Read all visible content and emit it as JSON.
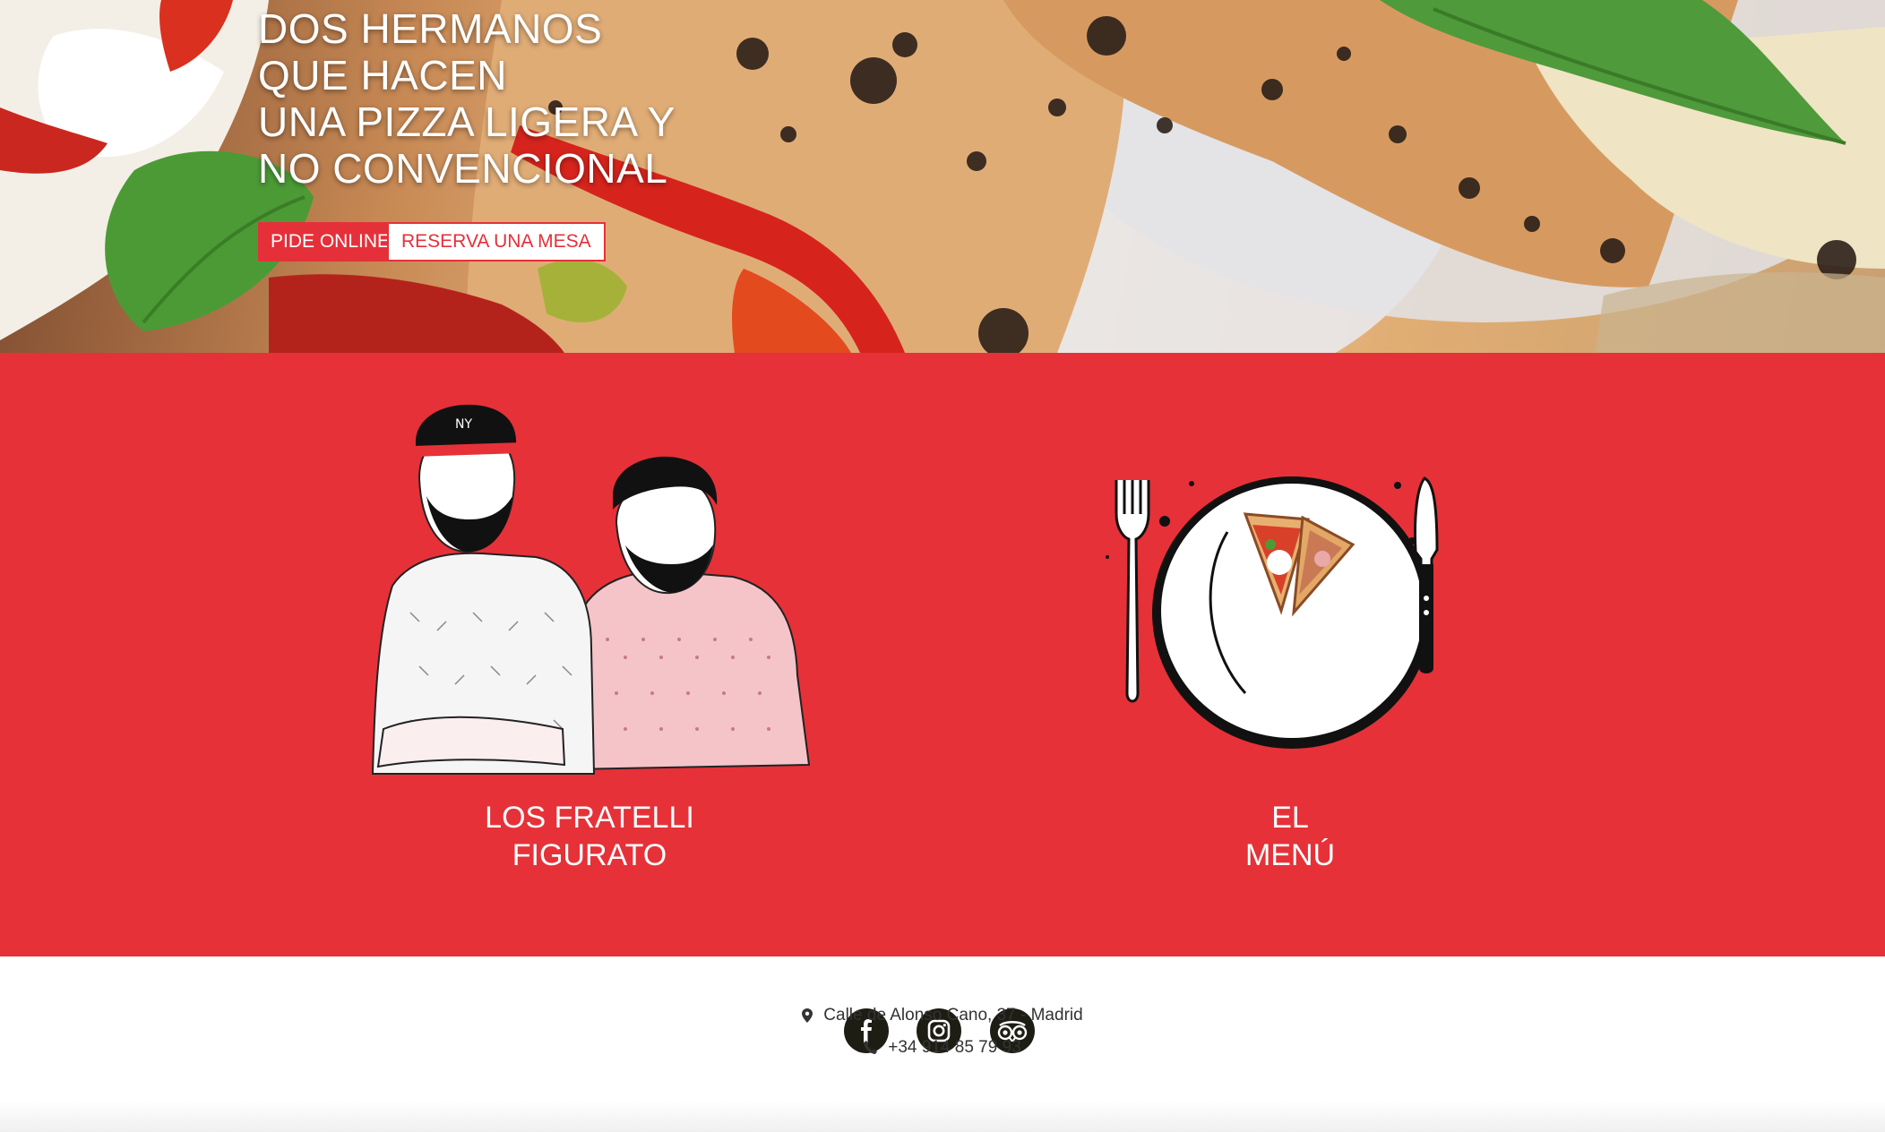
{
  "hero": {
    "title_lines": [
      "DOS HERMANOS",
      "QUE HACEN",
      "UNA PIZZA LIGERA Y",
      "NO CONVENCIONAL"
    ],
    "order_button": "PIDE ONLINE",
    "reserve_button": "RESERVA UNA MESA"
  },
  "features": {
    "brothers": {
      "line1": "LOS FRATELLI",
      "line2": "FIGURATO"
    },
    "menu": {
      "line1": "EL",
      "line2": "MENÚ"
    }
  },
  "footer": {
    "social": [
      "facebook-icon",
      "instagram-icon",
      "tripadvisor-icon"
    ],
    "address": "Calle de Alonso Cano, 37 - Madrid",
    "phone": "+34 914 85 79 93"
  },
  "colors": {
    "brand_red": "#e63138",
    "button_red": "#e5303a",
    "social_bg": "#1d1d14"
  }
}
